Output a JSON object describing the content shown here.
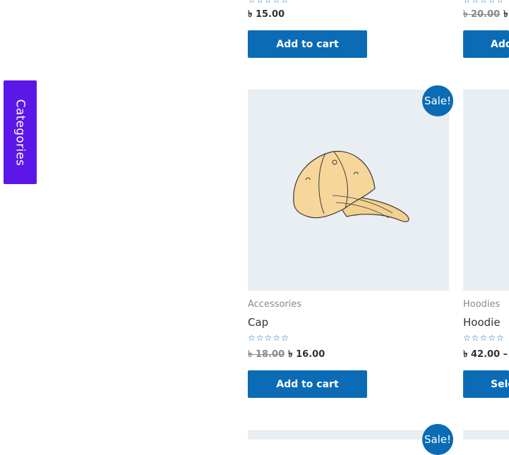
{
  "sidebar_tab": {
    "label": "Categories"
  },
  "top_row": {
    "left": {
      "price": "৳ 15.00",
      "button": "Add to cart"
    },
    "right": {
      "price_old": "৳ 20.00",
      "price_new": "৳",
      "button": "Add"
    }
  },
  "middle_row": {
    "left": {
      "sale_badge": "Sale!",
      "category": "Accessories",
      "title": "Cap",
      "price_old": "৳ 18.00",
      "price_new": "৳ 16.00",
      "button": "Add to cart"
    },
    "right": {
      "category": "Hoodies",
      "title": "Hoodie",
      "price": "৳ 42.00 –",
      "button": "Sele"
    }
  },
  "bottom_row": {
    "left": {
      "sale_badge": "Sale!"
    }
  },
  "colors": {
    "accent": "#0b6bb5",
    "tab": "#5b17e8",
    "image_bg": "#e9eef3"
  },
  "icons": {
    "rating": "star-outline-icon"
  }
}
